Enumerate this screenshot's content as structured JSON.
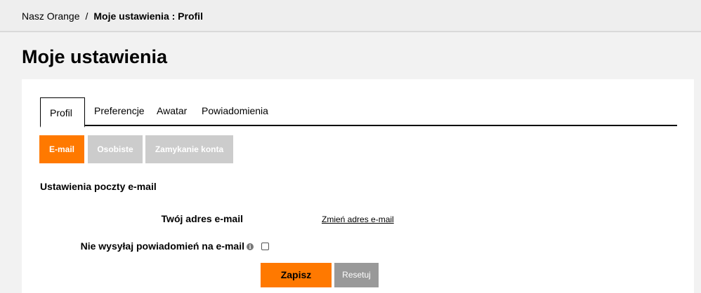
{
  "breadcrumb": {
    "home": "Nasz Orange",
    "separator": "/",
    "current": "Moje ustawienia : Profil"
  },
  "page": {
    "title": "Moje ustawienia"
  },
  "tabs": [
    {
      "label": "Profil",
      "active": true
    },
    {
      "label": "Preferencje",
      "active": false
    },
    {
      "label": "Awatar",
      "active": false
    },
    {
      "label": "Powiadomienia",
      "active": false
    }
  ],
  "subtabs": [
    {
      "label": "E-mail",
      "active": true
    },
    {
      "label": "Osobiste",
      "active": false
    },
    {
      "label": "Zamykanie konta",
      "active": false
    }
  ],
  "email_settings": {
    "section_title": "Ustawienia poczty e-mail",
    "address_label": "Twój adres e-mail",
    "change_link": "Zmień adres e-mail",
    "no_notifications_label": "Nie wysyłaj powiadomień na e-mail",
    "no_notifications_checked": false
  },
  "actions": {
    "save": "Zapisz",
    "reset": "Resetuj"
  },
  "colors": {
    "accent": "#ff7900",
    "inactive_subtab": "#cccccc",
    "reset_button": "#999999",
    "page_background": "#f2f2f2"
  },
  "icons": {
    "info": "info-icon"
  }
}
